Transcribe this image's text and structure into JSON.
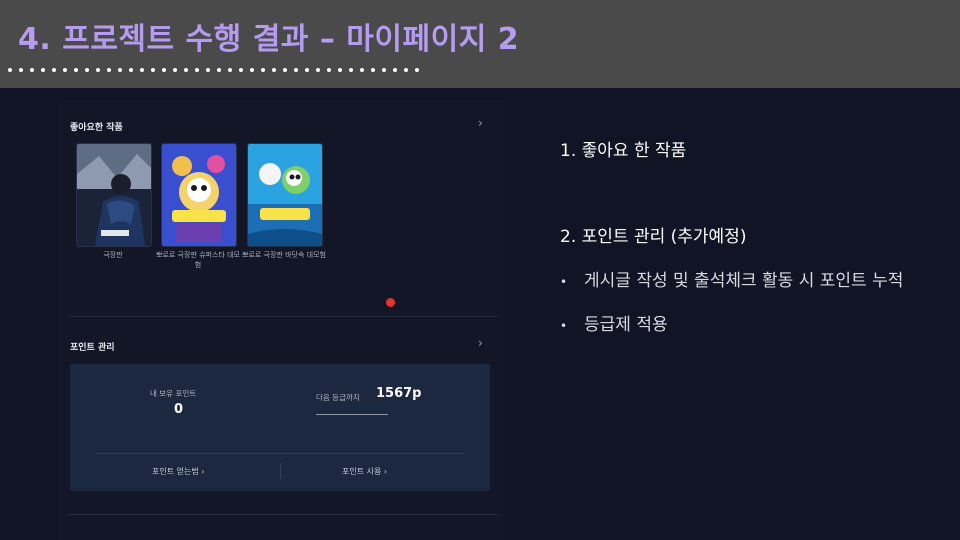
{
  "slide": {
    "title": "4. 프로젝트 수행 결과 – 마이페이지 2"
  },
  "screenshot": {
    "liked_section": {
      "title": "좋아요한 작품",
      "chevron": "›",
      "items": [
        {
          "caption": "극장판"
        },
        {
          "caption": "뽀로로 극장판 슈퍼스타 대모험"
        },
        {
          "caption": "뽀로로 극장판 바닷속 대모험"
        }
      ]
    },
    "points_section": {
      "title": "포인트 관리",
      "chevron": "›",
      "my_points_label": "내 보유 포인트",
      "my_points_value": "0",
      "next_grade_label": "다음 등급까지",
      "next_grade_value": "1567p",
      "earn_link": "포인트 얻는법 ›",
      "use_link": "포인트 사용 ›"
    }
  },
  "notes": {
    "item1": "1.  좋아요 한 작품",
    "item2": "2.  포인트 관리 (추가예정)",
    "bullets": [
      "게시글 작성 및 출석체크  활동 시 포인트 누적",
      "등급제 적용"
    ],
    "bullet_symbol": "•"
  },
  "colors": {
    "header_bg": "#4a4a4a",
    "title": "#b59cf0",
    "page_bg": "#111424",
    "point_box": "#1c2840",
    "notification": "#e8322d"
  }
}
